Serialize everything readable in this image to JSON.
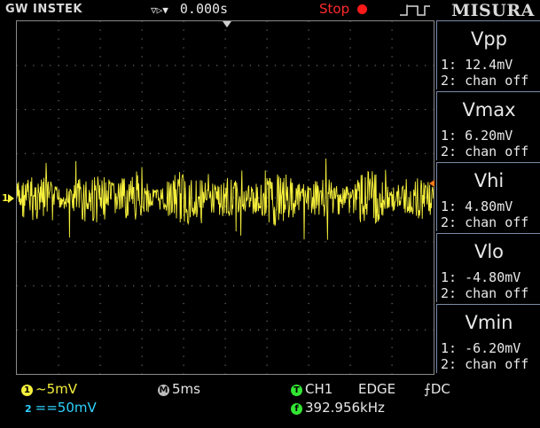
{
  "header": {
    "brand": "GW INSTEK",
    "delay_arrows": "▽▷▼",
    "delay": "0.000s",
    "status": "Stop",
    "menu_title": "MISURA"
  },
  "measurements": [
    {
      "name": "Vpp",
      "ch1": "1: 12.4mV",
      "ch2": "2: chan off"
    },
    {
      "name": "Vmax",
      "ch1": "1: 6.20mV",
      "ch2": "2: chan off"
    },
    {
      "name": "Vhi",
      "ch1": "1: 4.80mV",
      "ch2": "2: chan off"
    },
    {
      "name": "Vlo",
      "ch1": "1: -4.80mV",
      "ch2": "2: chan off"
    },
    {
      "name": "Vmin",
      "ch1": "1: -6.20mV",
      "ch2": "2: chan off"
    }
  ],
  "bottom": {
    "ch1_badge": "1",
    "ch1_scale": "~5mV",
    "ch2_badge": "2",
    "ch2_scale": "==50mV",
    "timebase_badge": "M",
    "timebase": "5ms",
    "trigger_badge": "T",
    "trigger_source": "CH1",
    "trigger_type": "EDGE",
    "coupling": "⨍DC",
    "freq_badge": "f",
    "frequency": "392.956kHz"
  },
  "ch1_marker_label": "1",
  "colors": {
    "ch1": "#f6f03c",
    "ch2": "#2fd3ff",
    "stop": "#ff1a1a",
    "grid_dots": "#6e6e6e",
    "panel_border": "#7a8aa8"
  }
}
